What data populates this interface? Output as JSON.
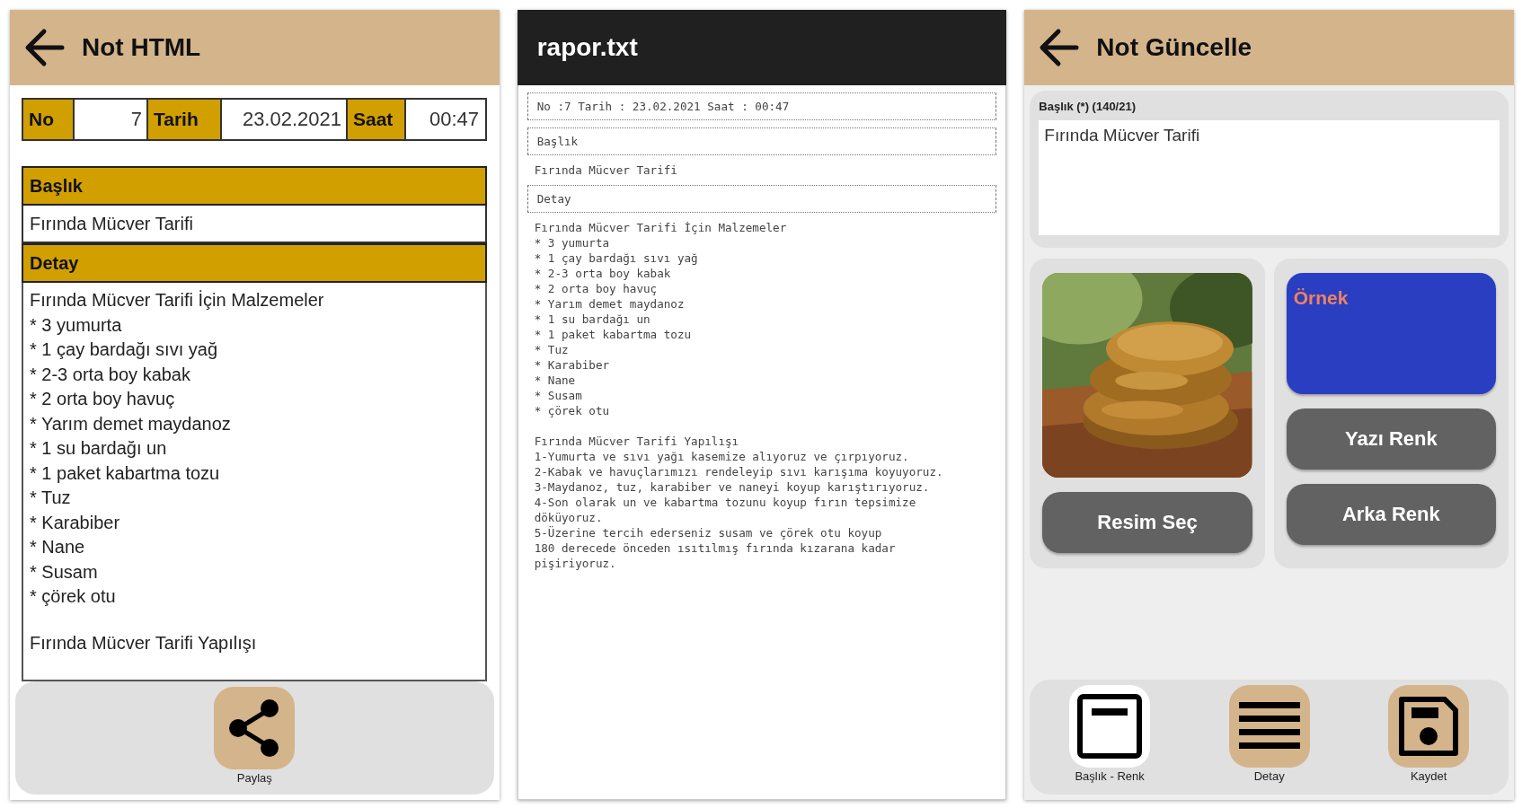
{
  "note_html": {
    "title": "Not HTML",
    "info": [
      {
        "label": "No",
        "value": "7"
      },
      {
        "label": "Tarih",
        "value": "23.02.2021"
      },
      {
        "label": "Saat",
        "value": "00:47"
      }
    ],
    "title_section": {
      "heading": "Başlık",
      "value": "Fırında Mücver Tarifi"
    },
    "detail_section": {
      "heading": "Detay",
      "paragraphs": [
        [
          "Fırında Mücver Tarifi İçin Malzemeler",
          "* 3 yumurta",
          "* 1 çay bardağı sıvı yağ",
          "* 2-3 orta boy kabak",
          "* 2 orta boy havuç",
          "* Yarım demet maydanoz",
          "* 1 su bardağı un",
          "* 1 paket kabartma tozu",
          "* Tuz",
          "* Karabiber",
          "* Nane",
          "* Susam",
          "* çörek otu"
        ],
        [
          "Fırında Mücver Tarifi Yapılışı"
        ]
      ]
    },
    "share": {
      "label": "Paylaş"
    }
  },
  "text_report": {
    "title": "rapor.txt",
    "blocks": [
      {
        "kind": "boxed",
        "text": "No :7 Tarih : 23.02.2021 Saat : 00:47"
      },
      {
        "kind": "boxed",
        "text": "Başlık"
      },
      {
        "kind": "plain",
        "paragraphs": [
          [
            "Fırında Mücver Tarifi"
          ]
        ]
      },
      {
        "kind": "boxed",
        "text": "Detay"
      },
      {
        "kind": "plain",
        "paragraphs": [
          [
            "Fırında Mücver Tarifi İçin Malzemeler",
            "* 3 yumurta",
            "* 1 çay bardağı sıvı yağ",
            "* 2-3 orta boy kabak",
            "* 2 orta boy havuç",
            "* Yarım demet maydanoz",
            "* 1 su bardağı un",
            "* 1 paket kabartma tozu",
            "* Tuz",
            "* Karabiber",
            "* Nane",
            "* Susam",
            "* çörek otu"
          ],
          [
            "Fırında Mücver Tarifi Yapılışı",
            "1-Yumurta ve sıvı yağı kasemize alıyoruz ve çırpıyoruz.",
            "2-Kabak ve havuçlarımızı rendeleyip sıvı karışıma koyuyoruz.",
            "3-Maydanoz, tuz, karabiber ve naneyi koyup karıştırıyoruz.",
            "4-Son olarak un ve kabartma tozunu koyup fırın tepsimize döküyoruz.",
            "5-Üzerine tercih ederseniz susam ve çörek otu koyup",
            "180 derecede önceden ısıtılmış fırında kızarana kadar pişiriyoruz."
          ]
        ]
      }
    ]
  },
  "note_update": {
    "title": "Not Güncelle",
    "title_field": {
      "label": "Başlık (*) (140/21)",
      "value": "Fırında Mücver Tarifi"
    },
    "image": {
      "kind": "picture"
    },
    "pick_image_button": "Resim Seç",
    "preview": {
      "text": "Örnek"
    },
    "color_buttons": [
      "Yazı Renk",
      "Arka Renk"
    ],
    "nav": [
      {
        "kind": "window",
        "label": "Başlık - Renk",
        "selected": true
      },
      {
        "kind": "list",
        "label": "Detay",
        "selected": false
      },
      {
        "kind": "save",
        "label": "Kaydet",
        "selected": false
      }
    ]
  }
}
